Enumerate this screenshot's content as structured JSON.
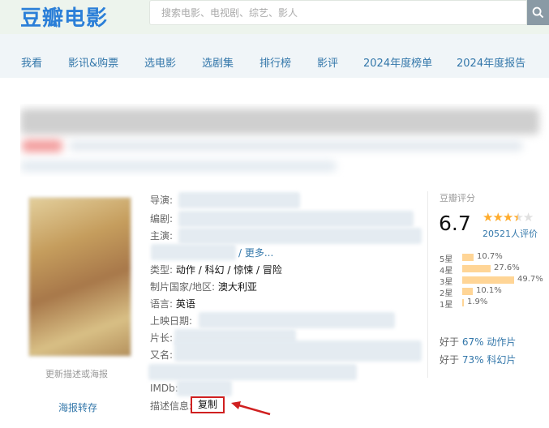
{
  "header": {
    "logo": "豆瓣电影",
    "search_placeholder": "搜索电影、电视剧、综艺、影人"
  },
  "nav": [
    "我看",
    "影讯&购票",
    "选电影",
    "选剧集",
    "排行榜",
    "影评",
    "2024年度榜单",
    "2024年度报告"
  ],
  "info": {
    "director_label": "导演:",
    "writer_label": "编剧:",
    "cast_label": "主演:",
    "more": "/ 更多...",
    "genre_label": "类型:",
    "genre_value": "动作 / 科幻 / 惊悚 / 冒险",
    "country_label": "制片国家/地区:",
    "country_value": "澳大利亚",
    "language_label": "语言:",
    "language_value": "英语",
    "release_label": "上映日期:",
    "runtime_label": "片长:",
    "aka_label": "又名:",
    "imdb_label": "IMDb:",
    "desc_label": "描述信息:",
    "copy_button": "复制"
  },
  "poster": {
    "update_link": "更新描述或海报",
    "save_link": "海报转存"
  },
  "rating": {
    "title": "豆瓣评分",
    "score": "6.7",
    "votes": "20521人评价",
    "distribution": [
      {
        "label": "5星",
        "percent": 10.7,
        "text": "10.7%"
      },
      {
        "label": "4星",
        "percent": 27.6,
        "text": "27.6%"
      },
      {
        "label": "3星",
        "percent": 49.7,
        "text": "49.7%"
      },
      {
        "label": "2星",
        "percent": 10.1,
        "text": "10.1%"
      },
      {
        "label": "1星",
        "percent": 1.9,
        "text": "1.9%"
      }
    ],
    "better_than": [
      {
        "prefix": "好于",
        "pct": "67%",
        "genre": "动作片"
      },
      {
        "prefix": "好于",
        "pct": "73%",
        "genre": "科幻片"
      }
    ]
  },
  "colors": {
    "link": "#3377aa",
    "star": "#ffac2d",
    "bar": "#ffd596",
    "highlight": "#d02020"
  }
}
